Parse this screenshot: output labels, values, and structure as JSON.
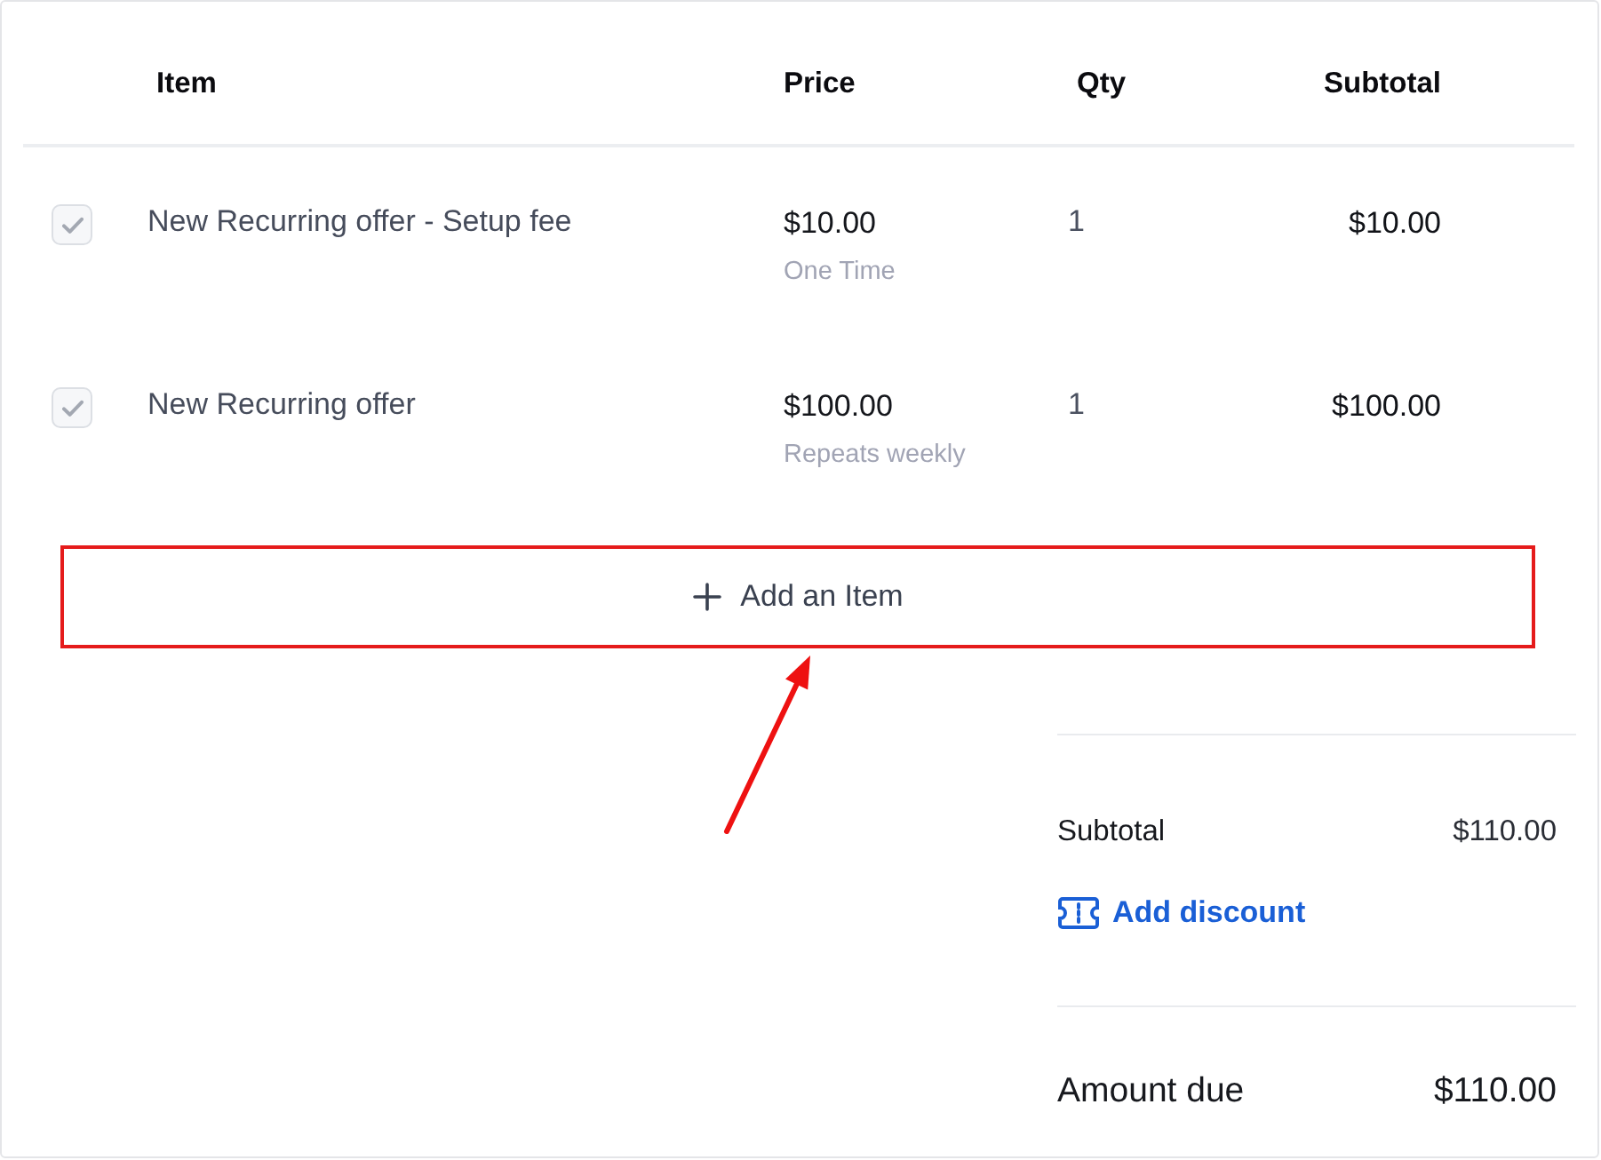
{
  "table": {
    "columns": [
      "Item",
      "Price",
      "Qty",
      "Subtotal"
    ],
    "rows": [
      {
        "checked": true,
        "disabled": true,
        "name": "New Recurring offer - Setup fee",
        "price": "$10.00",
        "billing": "One Time",
        "qty": "1",
        "subtotal": "$10.00"
      },
      {
        "checked": true,
        "disabled": true,
        "name": "New Recurring offer",
        "price": "$100.00",
        "billing": "Repeats weekly",
        "qty": "1",
        "subtotal": "$100.00"
      }
    ]
  },
  "add_item_button": {
    "label": "Add an Item",
    "highlighted": true
  },
  "summary": {
    "subtotal_label": "Subtotal",
    "subtotal_value": "$110.00",
    "discount_link": "Add discount",
    "amount_due_label": "Amount due",
    "amount_due_value": "$110.00"
  }
}
